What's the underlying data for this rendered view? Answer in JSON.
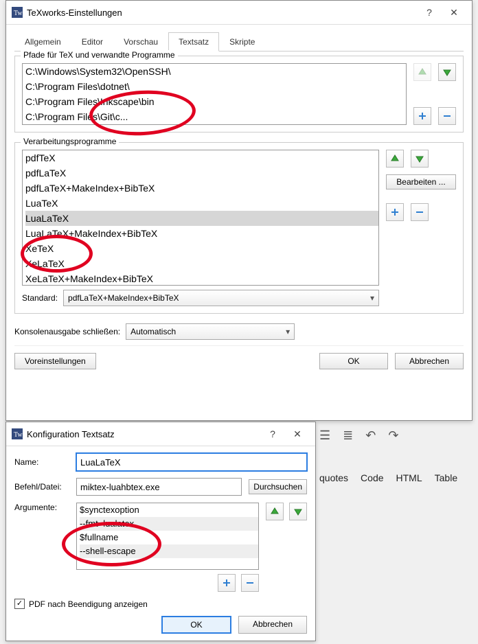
{
  "mainWindow": {
    "title": "TeXworks-Einstellungen",
    "tabs": [
      "Allgemein",
      "Editor",
      "Vorschau",
      "Textsatz",
      "Skripte"
    ],
    "activeTab": 3,
    "group_paths": {
      "label": "Pfade für TeX und verwandte Programme",
      "items": [
        "C:\\Windows\\System32\\OpenSSH\\",
        "C:\\Program Files\\dotnet\\",
        "C:\\Program Files\\Inkscape\\bin",
        "C:\\Program Files\\Git\\c..."
      ]
    },
    "group_tools": {
      "label": "Verarbeitungsprogramme",
      "items": [
        "pdfTeX",
        "pdfLaTeX",
        "pdfLaTeX+MakeIndex+BibTeX",
        "LuaTeX",
        "LuaLaTeX",
        "LuaLaTeX+MakeIndex+BibTeX",
        "XeTeX",
        "XeLaTeX",
        "XeLaTeX+MakeIndex+BibTeX"
      ],
      "selectedIndex": 4,
      "edit_btn": "Bearbeiten ...",
      "std_label": "Standard:",
      "std_value": "pdfLaTeX+MakeIndex+BibTeX"
    },
    "console_label": "Konsolenausgabe schließen:",
    "console_value": "Automatisch",
    "btn_defaults": "Voreinstellungen",
    "btn_ok": "OK",
    "btn_cancel": "Abbrechen"
  },
  "configWindow": {
    "title": "Konfiguration Textsatz",
    "name_label": "Name:",
    "name_value": "LuaLaTeX",
    "cmd_label": "Befehl/Datei:",
    "cmd_value": "miktex-luahbtex.exe",
    "browse_btn": "Durchsuchen",
    "args_label": "Argumente:",
    "args": [
      "$synctexoption",
      "--fmt=lualatex",
      "$fullname",
      "--shell-escape"
    ],
    "pdf_checkbox": "PDF nach Beendigung anzeigen",
    "btn_ok": "OK",
    "btn_cancel": "Abbrechen"
  },
  "bgToolbar": {
    "items": [
      "quotes",
      "Code",
      "HTML",
      "Table"
    ]
  }
}
